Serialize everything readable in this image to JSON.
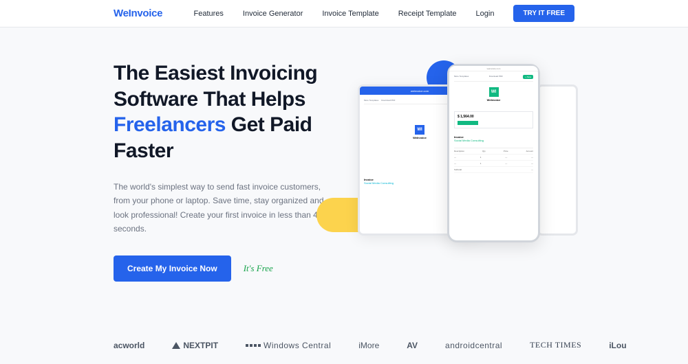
{
  "header": {
    "logo": "WeInvoice",
    "nav": {
      "features": "Features",
      "generator": "Invoice Generator",
      "template": "Invoice Template",
      "receipt": "Receipt Template",
      "login": "Login",
      "trial": "TRY IT FREE"
    }
  },
  "hero": {
    "title_1": "The Easiest Invoicing Software That Helps ",
    "title_highlight": "Freelancers",
    "title_2": " Get Paid Faster",
    "description": "The world's simplest way to send fast invoice customers, from your phone or laptop. Save time, stay organized and look professional! Create your first invoice in less than 40 seconds.",
    "cta_button": "Create My Invoice Now",
    "cta_note": "It's Free"
  },
  "mockup": {
    "url": "weinvoice.com",
    "menu_templates": "More Templates",
    "download_pdf": "Download PDF",
    "new_btn": "+ New",
    "logo_text": "WI",
    "brand": "WeInvoice",
    "price": "$ 1,564.00",
    "invoice_label": "Invoice",
    "invoice_sub": "Social Media Consulting",
    "col_desc": "Description",
    "col_qty": "Qty",
    "col_price": "Price",
    "col_amount": "Amount",
    "subtotal": "Subtotal"
  },
  "brands": {
    "acworld": "acworld",
    "nextpit": "NEXTPIT",
    "windows": "Windows Central",
    "imore": "iMore",
    "android": "androidcentral",
    "techtimes": "TECH TIMES",
    "ilou": "iLou"
  }
}
